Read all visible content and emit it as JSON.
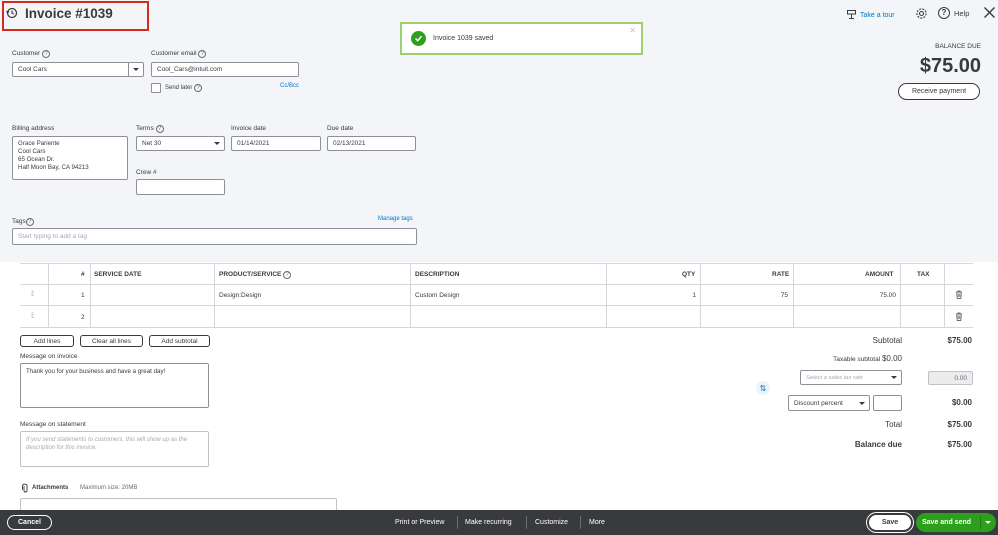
{
  "header": {
    "title": "Invoice #1039",
    "take_tour": "Take a tour",
    "help": "Help"
  },
  "toast": {
    "message": "Invoice 1039 saved"
  },
  "balance": {
    "label": "BALANCE DUE",
    "amount": "$75.00",
    "receive_payment": "Receive payment"
  },
  "customer": {
    "label": "Customer",
    "value": "Cool Cars"
  },
  "email": {
    "label": "Customer email",
    "value": "Cool_Cars@intuit.com",
    "send_later": "Send later",
    "ccbcc": "Cc/Bcc"
  },
  "billing": {
    "label": "Billing address",
    "lines": [
      "Grace Pariente",
      "Cool Cars",
      "65 Ocean Dr.",
      "Half Moon Bay, CA  94213"
    ]
  },
  "terms": {
    "label": "Terms",
    "value": "Net 30"
  },
  "invoice_date": {
    "label": "Invoice date",
    "value": "01/14/2021"
  },
  "due_date": {
    "label": "Due date",
    "value": "02/13/2021"
  },
  "crew": {
    "label": "Crew #",
    "value": ""
  },
  "tags": {
    "label": "Tags",
    "manage": "Manage tags",
    "placeholder": "Start typing to add a tag"
  },
  "table": {
    "headers": {
      "num": "#",
      "service_date": "SERVICE DATE",
      "product": "PRODUCT/SERVICE",
      "description": "DESCRIPTION",
      "qty": "QTY",
      "rate": "RATE",
      "amount": "AMOUNT",
      "tax": "TAX"
    },
    "rows": [
      {
        "num": "1",
        "service_date": "",
        "product": "Design:Design",
        "description": "Custom Design",
        "qty": "1",
        "rate": "75",
        "amount": "75.00"
      },
      {
        "num": "2",
        "service_date": "",
        "product": "",
        "description": "",
        "qty": "",
        "rate": "",
        "amount": ""
      }
    ]
  },
  "line_buttons": {
    "add_lines": "Add lines",
    "clear_lines": "Clear all lines",
    "add_subtotal": "Add subtotal"
  },
  "message_invoice": {
    "label": "Message on invoice",
    "value": "Thank you for your business and have a great day!"
  },
  "message_statement": {
    "label": "Message on statement",
    "placeholder": "If you send statements to customers, this will show up as the description for this invoice."
  },
  "attachments": {
    "label": "Attachments",
    "max": "Maximum size: 20MB"
  },
  "totals": {
    "subtotal_label": "Subtotal",
    "subtotal": "$75.00",
    "taxable_label": "Taxable subtotal",
    "taxable": "$0.00",
    "tax_rate_placeholder": "Select a sales tax rate",
    "tax_amount": "0.00",
    "discount_type": "Discount percent",
    "discount_amount": "$0.00",
    "total_label": "Total",
    "total": "$75.00",
    "balance_label": "Balance due",
    "balance": "$75.00"
  },
  "footer": {
    "cancel": "Cancel",
    "print": "Print or Preview",
    "recurring": "Make recurring",
    "customize": "Customize",
    "more": "More",
    "save": "Save",
    "save_send": "Save and send"
  },
  "colors": {
    "brand_green": "#2ca01c",
    "link_blue": "#0077c5",
    "footer_dark": "#393a3d",
    "title_highlight": "#d52b1e"
  }
}
